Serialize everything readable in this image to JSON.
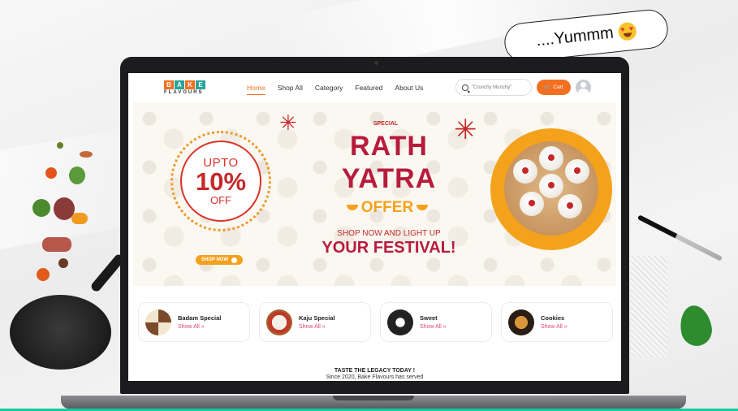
{
  "bubble": {
    "text": "....Yummm",
    "emoji": "heart-eyes-emoji"
  },
  "site": {
    "logo": {
      "letters": [
        "B",
        "A",
        "K",
        "E"
      ],
      "letter_colors": [
        "#f37021",
        "#2aa39a",
        "#f37021",
        "#2aa39a"
      ],
      "sub": "FLAVOURS"
    },
    "nav": {
      "items": [
        "Home",
        "Shop All",
        "Category",
        "Featured",
        "About Us"
      ],
      "active": "Home"
    },
    "search": {
      "placeholder": "\"Crunchy Munchy\""
    },
    "cart": {
      "label": "Cart"
    }
  },
  "banner": {
    "upto": "UPTO",
    "percent": "10%",
    "off": "OFF",
    "shop_now": "SHOP NOW",
    "special": "SPECIAL",
    "line1": "RATH",
    "line2": "YATRA",
    "offer": "OFFER",
    "subtitle": "SHOP NOW AND LIGHT UP",
    "festival": "YOUR FESTIVAL!"
  },
  "categories": [
    {
      "title": "Badam Special",
      "link": "Show All »"
    },
    {
      "title": "Kaju Special",
      "link": "Show All »"
    },
    {
      "title": "Sweet",
      "link": "Show All »"
    },
    {
      "title": "Cookies",
      "link": "Show All »"
    }
  ],
  "footer": {
    "tagline": "TASTE THE LEGACY TODAY !",
    "since": "Since 2020, Bake Flavours has served"
  },
  "colors": {
    "accent": "#f37021",
    "brand_red": "#b71c3c",
    "gold": "#f5a11c",
    "link_pink": "#e0457b"
  }
}
